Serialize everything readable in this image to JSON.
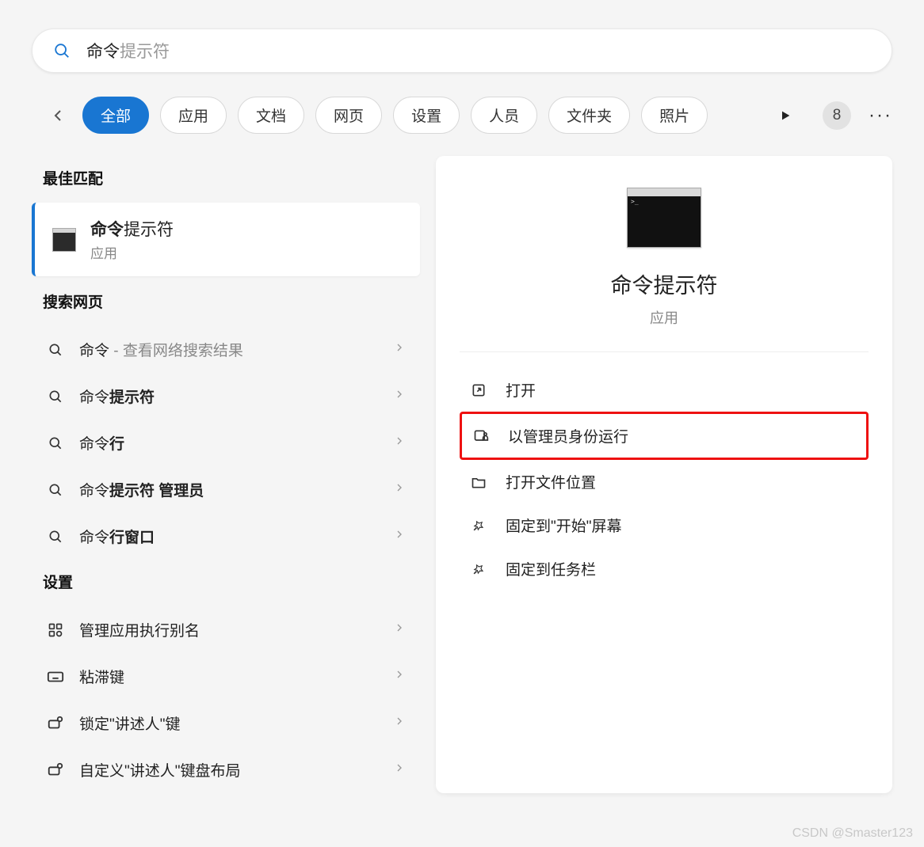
{
  "search": {
    "typed": "命令",
    "suggestion_tail": "提示符"
  },
  "tabs": [
    "全部",
    "应用",
    "文档",
    "网页",
    "设置",
    "人员",
    "文件夹",
    "照片"
  ],
  "active_tab_index": 0,
  "badge_count": "8",
  "sections": {
    "best_match_header": "最佳匹配",
    "best_match": {
      "title_bold": "命令",
      "title_rest": "提示符",
      "subtitle": "应用"
    },
    "web_header": "搜索网页",
    "web_items": [
      {
        "plain": "命令",
        "bold": "",
        "hint": " - 查看网络搜索结果"
      },
      {
        "plain": "命令",
        "bold": "提示符",
        "hint": ""
      },
      {
        "plain": "命令",
        "bold": "行",
        "hint": ""
      },
      {
        "plain": "命令",
        "bold": "提示符 管理员",
        "hint": ""
      },
      {
        "plain": "命令",
        "bold": "行窗口",
        "hint": ""
      }
    ],
    "settings_header": "设置",
    "settings_items": [
      {
        "label": "管理应用执行别名",
        "icon": "app-alias-icon"
      },
      {
        "label": "粘滞键",
        "icon": "keyboard-icon"
      },
      {
        "label": "锁定\"讲述人\"键",
        "icon": "narrator-key-icon"
      },
      {
        "label": "自定义\"讲述人\"键盘布局",
        "icon": "narrator-layout-icon"
      }
    ]
  },
  "preview": {
    "title": "命令提示符",
    "subtitle": "应用",
    "actions": [
      {
        "label": "打开",
        "icon": "open-icon",
        "highlight": false
      },
      {
        "label": "以管理员身份运行",
        "icon": "admin-icon",
        "highlight": true
      },
      {
        "label": "打开文件位置",
        "icon": "folder-icon",
        "highlight": false
      },
      {
        "label": "固定到\"开始\"屏幕",
        "icon": "pin-icon",
        "highlight": false
      },
      {
        "label": "固定到任务栏",
        "icon": "pin-icon",
        "highlight": false
      }
    ]
  },
  "watermark": "CSDN @Smaster123"
}
